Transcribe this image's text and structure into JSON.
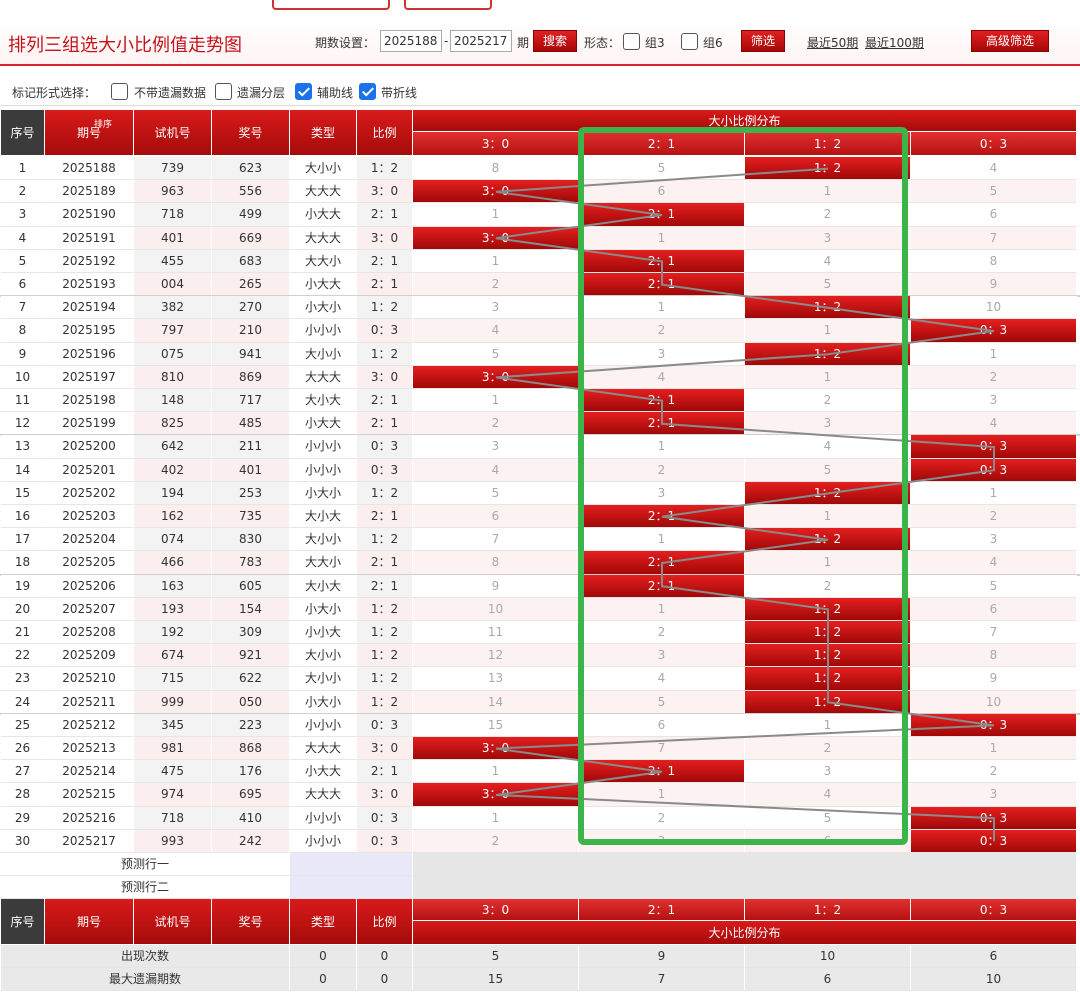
{
  "header": {
    "title": "排列三组选大小比例值走势图",
    "period_label": "期数设置：",
    "period_from": "2025188",
    "period_sep": "-",
    "period_to": "2025217",
    "period_unit": "期",
    "search_btn": "搜索",
    "shape_label": "形态：",
    "group3_label": "组3",
    "group6_label": "组6",
    "filter_btn": "筛选",
    "recent50": "最近50期",
    "recent100": "最近100期",
    "advanced_btn": "高级筛选"
  },
  "options": {
    "label": "标记形式选择：",
    "items": [
      {
        "label": "不带遗漏数据",
        "checked": false
      },
      {
        "label": "遗漏分层",
        "checked": false
      },
      {
        "label": "辅助线",
        "checked": true
      },
      {
        "label": "带折线",
        "checked": true
      }
    ]
  },
  "table": {
    "headers": {
      "index": "序号",
      "period": "期号",
      "sort": "排序",
      "trial": "试机号",
      "draw": "奖号",
      "type": "类型",
      "ratio": "比例",
      "dist": "大小比例分布"
    },
    "dist_cols": [
      "3：0",
      "2：1",
      "1：2",
      "0：3"
    ],
    "rows": [
      {
        "idx": "1",
        "period": "2025188",
        "trial": "739",
        "draw": "623",
        "type": "大小小",
        "ratio": "1：2",
        "hit": 2,
        "cells": [
          "8",
          "5",
          "1：2",
          "4"
        ]
      },
      {
        "idx": "2",
        "period": "2025189",
        "trial": "963",
        "draw": "556",
        "type": "大大大",
        "ratio": "3：0",
        "hit": 0,
        "cells": [
          "3：0",
          "6",
          "1",
          "5"
        ]
      },
      {
        "idx": "3",
        "period": "2025190",
        "trial": "718",
        "draw": "499",
        "type": "小大大",
        "ratio": "2：1",
        "hit": 1,
        "cells": [
          "1",
          "2：1",
          "2",
          "6"
        ]
      },
      {
        "idx": "4",
        "period": "2025191",
        "trial": "401",
        "draw": "669",
        "type": "大大大",
        "ratio": "3：0",
        "hit": 0,
        "cells": [
          "3：0",
          "1",
          "3",
          "7"
        ]
      },
      {
        "idx": "5",
        "period": "2025192",
        "trial": "455",
        "draw": "683",
        "type": "大大小",
        "ratio": "2：1",
        "hit": 1,
        "cells": [
          "1",
          "2：1",
          "4",
          "8"
        ]
      },
      {
        "idx": "6",
        "period": "2025193",
        "trial": "004",
        "draw": "265",
        "type": "小大大",
        "ratio": "2：1",
        "hit": 1,
        "cells": [
          "2",
          "2：1",
          "5",
          "9"
        ]
      },
      {
        "idx": "7",
        "period": "2025194",
        "trial": "382",
        "draw": "270",
        "type": "小大小",
        "ratio": "1：2",
        "hit": 2,
        "cells": [
          "3",
          "1",
          "1：2",
          "10"
        ]
      },
      {
        "idx": "8",
        "period": "2025195",
        "trial": "797",
        "draw": "210",
        "type": "小小小",
        "ratio": "0：3",
        "hit": 3,
        "cells": [
          "4",
          "2",
          "1",
          "0：3"
        ]
      },
      {
        "idx": "9",
        "period": "2025196",
        "trial": "075",
        "draw": "941",
        "type": "大小小",
        "ratio": "1：2",
        "hit": 2,
        "cells": [
          "5",
          "3",
          "1：2",
          "1"
        ]
      },
      {
        "idx": "10",
        "period": "2025197",
        "trial": "810",
        "draw": "869",
        "type": "大大大",
        "ratio": "3：0",
        "hit": 0,
        "cells": [
          "3：0",
          "4",
          "1",
          "2"
        ]
      },
      {
        "idx": "11",
        "period": "2025198",
        "trial": "148",
        "draw": "717",
        "type": "大小大",
        "ratio": "2：1",
        "hit": 1,
        "cells": [
          "1",
          "2：1",
          "2",
          "3"
        ]
      },
      {
        "idx": "12",
        "period": "2025199",
        "trial": "825",
        "draw": "485",
        "type": "小大大",
        "ratio": "2：1",
        "hit": 1,
        "cells": [
          "2",
          "2：1",
          "3",
          "4"
        ]
      },
      {
        "idx": "13",
        "period": "2025200",
        "trial": "642",
        "draw": "211",
        "type": "小小小",
        "ratio": "0：3",
        "hit": 3,
        "cells": [
          "3",
          "1",
          "4",
          "0：3"
        ]
      },
      {
        "idx": "14",
        "period": "2025201",
        "trial": "402",
        "draw": "401",
        "type": "小小小",
        "ratio": "0：3",
        "hit": 3,
        "cells": [
          "4",
          "2",
          "5",
          "0：3"
        ]
      },
      {
        "idx": "15",
        "period": "2025202",
        "trial": "194",
        "draw": "253",
        "type": "小大小",
        "ratio": "1：2",
        "hit": 2,
        "cells": [
          "5",
          "3",
          "1：2",
          "1"
        ]
      },
      {
        "idx": "16",
        "period": "2025203",
        "trial": "162",
        "draw": "735",
        "type": "大小大",
        "ratio": "2：1",
        "hit": 1,
        "cells": [
          "6",
          "2：1",
          "1",
          "2"
        ]
      },
      {
        "idx": "17",
        "period": "2025204",
        "trial": "074",
        "draw": "830",
        "type": "大小小",
        "ratio": "1：2",
        "hit": 2,
        "cells": [
          "7",
          "1",
          "1：2",
          "3"
        ]
      },
      {
        "idx": "18",
        "period": "2025205",
        "trial": "466",
        "draw": "783",
        "type": "大大小",
        "ratio": "2：1",
        "hit": 1,
        "cells": [
          "8",
          "2：1",
          "1",
          "4"
        ]
      },
      {
        "idx": "19",
        "period": "2025206",
        "trial": "163",
        "draw": "605",
        "type": "大小大",
        "ratio": "2：1",
        "hit": 1,
        "cells": [
          "9",
          "2：1",
          "2",
          "5"
        ]
      },
      {
        "idx": "20",
        "period": "2025207",
        "trial": "193",
        "draw": "154",
        "type": "小大小",
        "ratio": "1：2",
        "hit": 2,
        "cells": [
          "10",
          "1",
          "1：2",
          "6"
        ]
      },
      {
        "idx": "21",
        "period": "2025208",
        "trial": "192",
        "draw": "309",
        "type": "小小大",
        "ratio": "1：2",
        "hit": 2,
        "cells": [
          "11",
          "2",
          "1：2",
          "7"
        ]
      },
      {
        "idx": "22",
        "period": "2025209",
        "trial": "674",
        "draw": "921",
        "type": "大小小",
        "ratio": "1：2",
        "hit": 2,
        "cells": [
          "12",
          "3",
          "1：2",
          "8"
        ]
      },
      {
        "idx": "23",
        "period": "2025210",
        "trial": "715",
        "draw": "622",
        "type": "大小小",
        "ratio": "1：2",
        "hit": 2,
        "cells": [
          "13",
          "4",
          "1：2",
          "9"
        ]
      },
      {
        "idx": "24",
        "period": "2025211",
        "trial": "999",
        "draw": "050",
        "type": "小大小",
        "ratio": "1：2",
        "hit": 2,
        "cells": [
          "14",
          "5",
          "1：2",
          "10"
        ]
      },
      {
        "idx": "25",
        "period": "2025212",
        "trial": "345",
        "draw": "223",
        "type": "小小小",
        "ratio": "0：3",
        "hit": 3,
        "cells": [
          "15",
          "6",
          "1",
          "0：3"
        ]
      },
      {
        "idx": "26",
        "period": "2025213",
        "trial": "981",
        "draw": "868",
        "type": "大大大",
        "ratio": "3：0",
        "hit": 0,
        "cells": [
          "3：0",
          "7",
          "2",
          "1"
        ]
      },
      {
        "idx": "27",
        "period": "2025214",
        "trial": "475",
        "draw": "176",
        "type": "小大大",
        "ratio": "2：1",
        "hit": 1,
        "cells": [
          "1",
          "2：1",
          "3",
          "2"
        ]
      },
      {
        "idx": "28",
        "period": "2025215",
        "trial": "974",
        "draw": "695",
        "type": "大大大",
        "ratio": "3：0",
        "hit": 0,
        "cells": [
          "3：0",
          "1",
          "4",
          "3"
        ]
      },
      {
        "idx": "29",
        "period": "2025216",
        "trial": "718",
        "draw": "410",
        "type": "小小小",
        "ratio": "0：3",
        "hit": 3,
        "cells": [
          "1",
          "2",
          "5",
          "0：3"
        ]
      },
      {
        "idx": "30",
        "period": "2025217",
        "trial": "993",
        "draw": "242",
        "type": "小小小",
        "ratio": "0：3",
        "hit": 3,
        "cells": [
          "2",
          "3",
          "6",
          "0：3"
        ]
      }
    ],
    "predict_rows": [
      "预测行一",
      "预测行二"
    ],
    "footer_headers": {
      "index": "序号",
      "period": "期号",
      "trial": "试机号",
      "draw": "奖号",
      "type": "类型",
      "ratio": "比例",
      "dist": "大小比例分布"
    },
    "stats": [
      {
        "label": "出现次数",
        "type": "0",
        "ratio": "0",
        "vals": [
          "5",
          "9",
          "10",
          "6"
        ]
      },
      {
        "label": "最大遗漏期数",
        "type": "0",
        "ratio": "0",
        "vals": [
          "15",
          "7",
          "6",
          "10"
        ]
      }
    ]
  },
  "colors": {
    "accent": "#c4131a",
    "hit": "#d61515",
    "highlight_box": "#3bb54a"
  }
}
